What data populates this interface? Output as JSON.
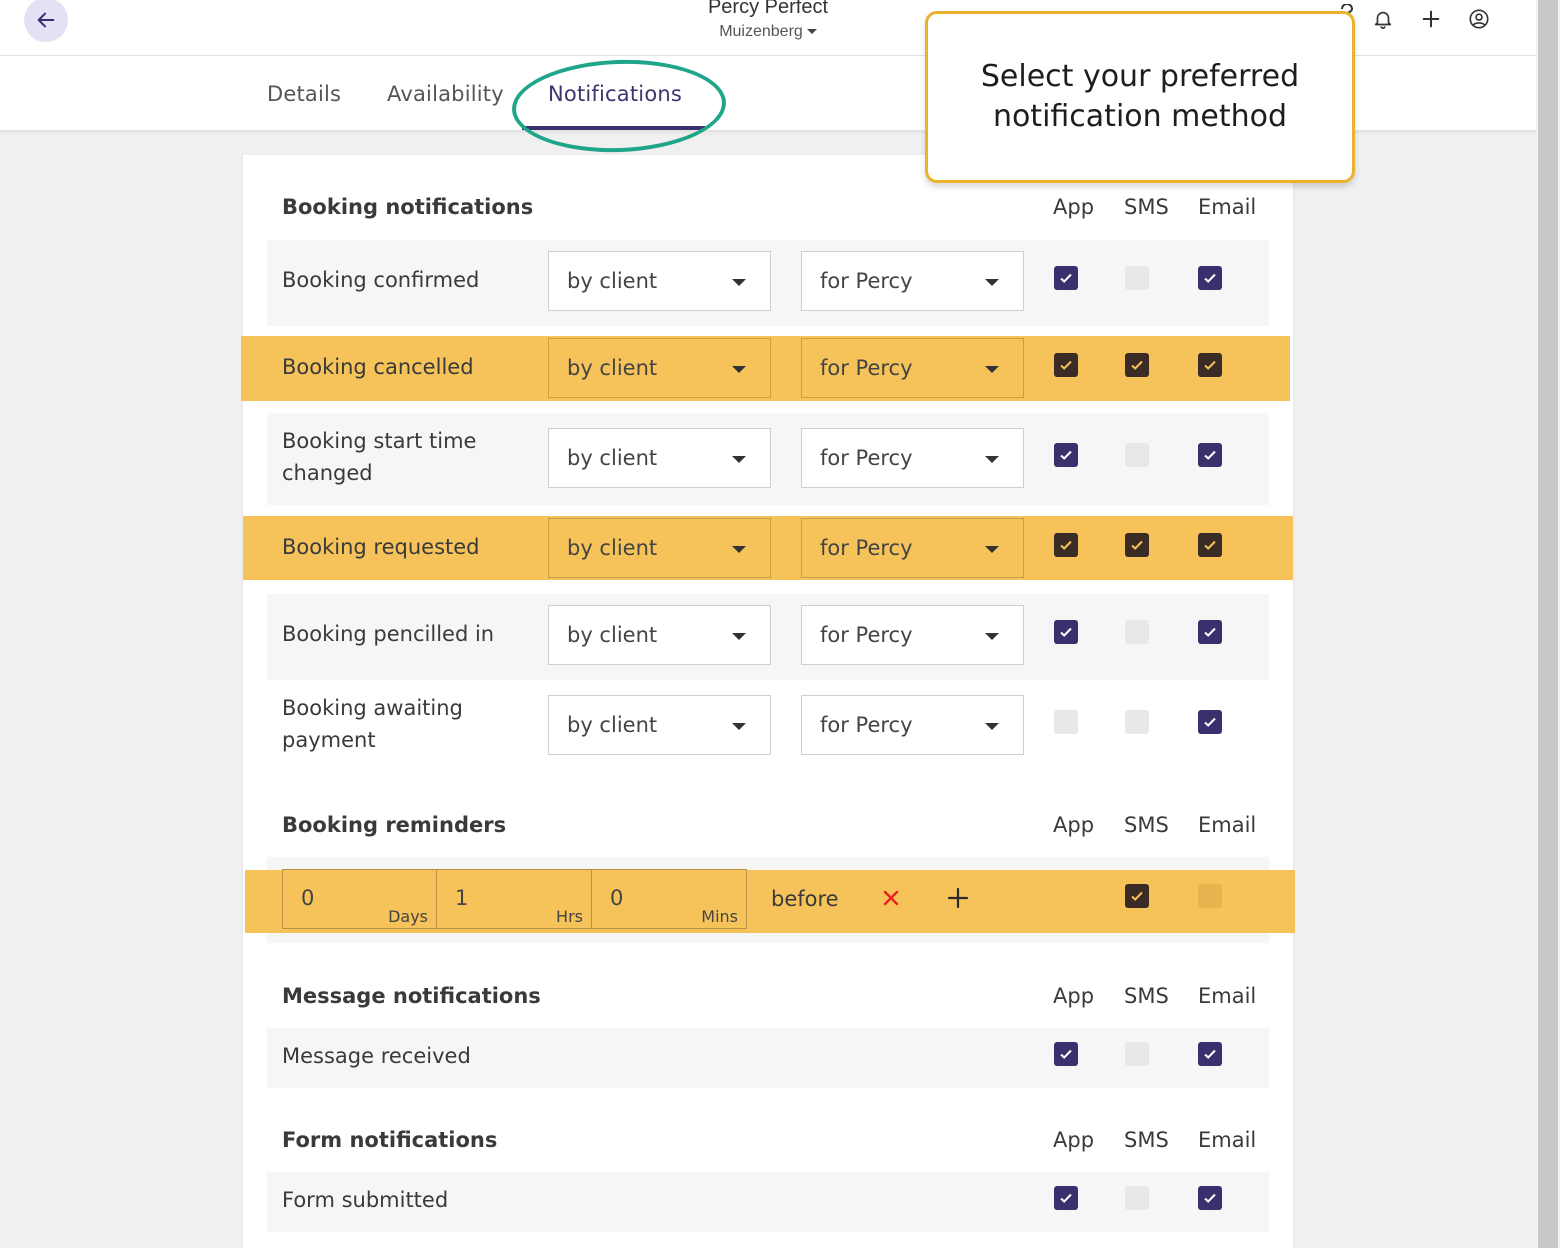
{
  "header": {
    "user_name": "Percy Perfect",
    "location": "Muizenberg"
  },
  "tabs": [
    {
      "label": "Details"
    },
    {
      "label": "Availability"
    },
    {
      "label": "Notifications",
      "active": true
    }
  ],
  "tooltip": "Select your preferred notification method",
  "columns": {
    "app": "App",
    "sms": "SMS",
    "email": "Email"
  },
  "booking": {
    "title": "Booking notifications",
    "rows": [
      {
        "label": "Booking confirmed",
        "by": "by client",
        "for": "for Percy",
        "app": true,
        "sms": false,
        "email": true,
        "highlight": false
      },
      {
        "label": "Booking cancelled",
        "by": "by client",
        "for": "for Percy",
        "app": true,
        "sms": true,
        "email": true,
        "highlight": true
      },
      {
        "label": "Booking start time changed",
        "by": "by client",
        "for": "for Percy",
        "app": true,
        "sms": false,
        "email": true,
        "highlight": false
      },
      {
        "label": "Booking requested",
        "by": "by client",
        "for": "for Percy",
        "app": true,
        "sms": true,
        "email": true,
        "highlight": true
      },
      {
        "label": "Booking pencilled in",
        "by": "by client",
        "for": "for Percy",
        "app": true,
        "sms": false,
        "email": true,
        "highlight": false
      },
      {
        "label": "Booking awaiting payment",
        "by": "by client",
        "for": "for Percy",
        "app": false,
        "sms": false,
        "email": true,
        "highlight": false
      }
    ]
  },
  "reminders": {
    "title": "Booking reminders",
    "days_value": "0",
    "days_unit": "Days",
    "hrs_value": "1",
    "hrs_unit": "Hrs",
    "mins_value": "0",
    "mins_unit": "Mins",
    "before": "before",
    "remove_icon": "close-icon",
    "add_icon": "plus-icon",
    "sms": true,
    "email": false
  },
  "messages": {
    "title": "Message notifications",
    "rows": [
      {
        "label": "Message received",
        "app": true,
        "sms": false,
        "email": true
      }
    ]
  },
  "forms": {
    "title": "Form notifications",
    "rows": [
      {
        "label": "Form submitted",
        "app": true,
        "sms": false,
        "email": true
      }
    ]
  },
  "colors": {
    "accent": "#3b2f6e",
    "highlight": "#f6c35a",
    "circle": "#1fa589",
    "tooltip_border": "#ecb22e"
  }
}
